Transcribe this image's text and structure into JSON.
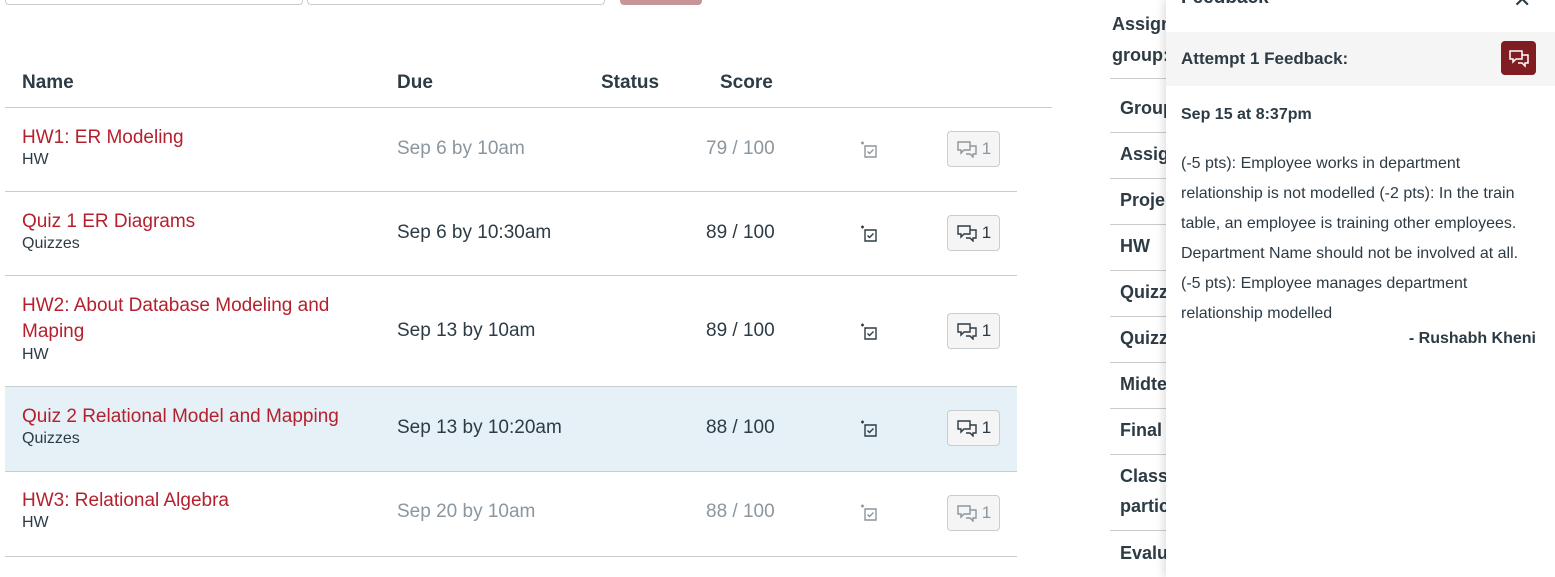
{
  "table": {
    "headers": {
      "name": "Name",
      "due": "Due",
      "status": "Status",
      "score": "Score"
    },
    "rows": [
      {
        "title": "HW1: ER Modeling",
        "group": "HW",
        "due": "Sep 6 by 10am",
        "status": "",
        "score": "79 / 100",
        "comment_count": "1"
      },
      {
        "title": "Quiz 1 ER Diagrams",
        "group": "Quizzes",
        "due": "Sep 6 by 10:30am",
        "status": "",
        "score": "89 / 100",
        "comment_count": "1"
      },
      {
        "title": "HW2: About Database Modeling and Maping",
        "group": "HW",
        "due": "Sep 13 by 10am",
        "status": "",
        "score": "89 / 100",
        "comment_count": "1"
      },
      {
        "title": "Quiz 2 Relational Model and Mapping",
        "group": "Quizzes",
        "due": "Sep 13 by 10:20am",
        "status": "",
        "score": "88 / 100",
        "comment_count": "1"
      },
      {
        "title": "HW3: Relational Algebra",
        "group": "HW",
        "due": "Sep 20 by 10am",
        "status": "",
        "score": "88 / 100",
        "comment_count": "1"
      }
    ]
  },
  "sidebar": {
    "labels": [
      "Assign",
      "group:",
      "Group",
      "Assig",
      "Proje",
      "HW",
      "Quizz",
      "Quizz",
      "Midte",
      "Final",
      "Class",
      "partic",
      "Evalu"
    ]
  },
  "tray": {
    "title": "Feedback",
    "close_icon": "close-icon",
    "attempt_label": "Attempt 1 Feedback:",
    "date": "Sep 15 at 8:37pm",
    "comment": "(-5 pts): Employee works in department relationship is not modelled (-2 pts): In the train table, an employee is training other employees. Department Name should not be involved at all. (-5 pts): Employee manages department relationship modelled",
    "author": "- Rushabh Kheni"
  },
  "colors": {
    "link": "#b5202e",
    "selected_row": "#e5f1f7",
    "attempt_button": "#7f1d22"
  }
}
